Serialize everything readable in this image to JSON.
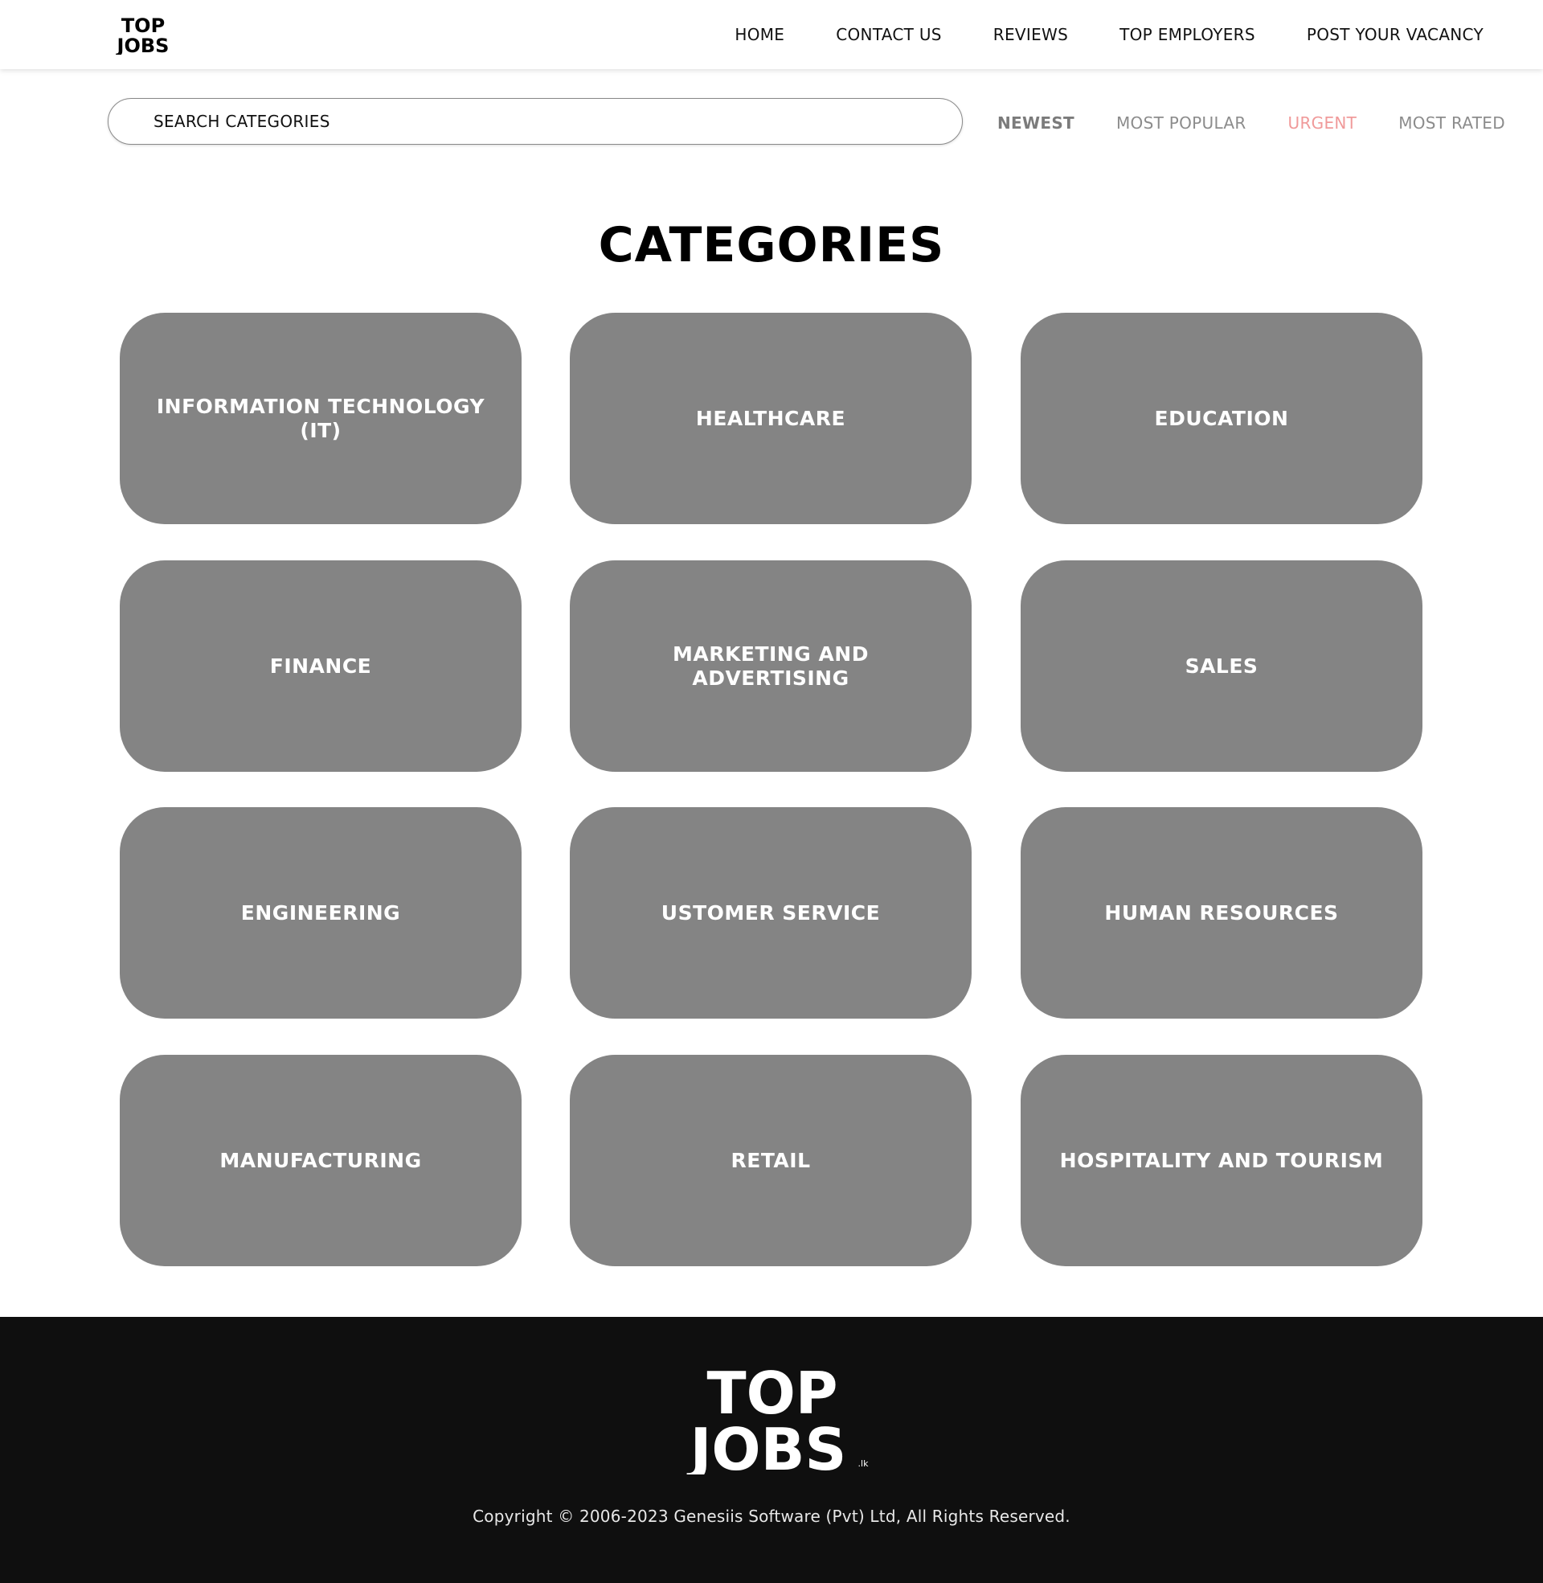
{
  "header": {
    "logo": {
      "line1": "TOP",
      "line2": "JOBS"
    },
    "nav": [
      "HOME",
      "CONTACT US",
      "REVIEWS",
      "TOP EMPLOYERS",
      "POST YOUR VACANCY"
    ]
  },
  "search": {
    "placeholder": "SEARCH CATEGORIES"
  },
  "filters": {
    "newest": "NEWEST",
    "most_popular": "MOST POPULAR",
    "urgent": "URGENT",
    "most_rated": "MOST RATED"
  },
  "page_title": "CATEGORIES",
  "categories": [
    "INFORMATION TECHNOLOGY (IT)",
    "HEALTHCARE",
    "EDUCATION",
    "FINANCE",
    "MARKETING AND ADVERTISING",
    "SALES",
    "ENGINEERING",
    "USTOMER SERVICE",
    "HUMAN RESOURCES",
    "MANUFACTURING",
    "RETAIL",
    "HOSPITALITY AND TOURISM"
  ],
  "footer": {
    "logo": {
      "line1": "TOP",
      "line2": "JOBS",
      "suffix": ".lk"
    },
    "copyright": "Copyright © 2006-2023 Genesiis Software (Pvt) Ltd, All Rights Reserved."
  },
  "colors": {
    "card": "#848484",
    "footer_bg": "#0f0f0f",
    "urgent": "#f09a9a"
  }
}
